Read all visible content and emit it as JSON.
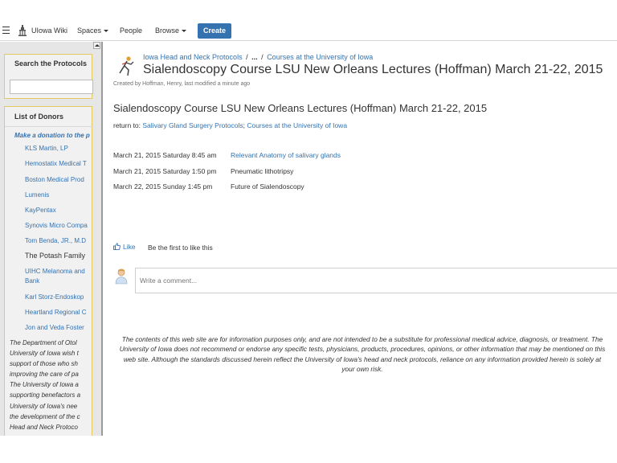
{
  "nav": {
    "site_name": "UIowa Wiki",
    "spaces": "Spaces",
    "people": "People",
    "browse": "Browse",
    "create": "Create"
  },
  "sidebar": {
    "search_title": "Search the Protocols",
    "donors_title": "List of Donors",
    "donate_link": "Make a donation to the p",
    "donors": [
      "KLS Martin, LP",
      "Hemostatix Medical T",
      "Boston Medical Prod",
      "Lumenis",
      "KayPentax",
      "Synovis Micro Compa",
      "Tom Benda, JR., M.D",
      "The Potash Family",
      "UIHC Melanoma and Bank",
      "Karl Storz-Endoskop",
      "Heartland Regional C",
      "Jon and Veda Foster"
    ],
    "paragraph_lines": [
      "The Department of Otol",
      "University of Iowa wish t",
      "support of those who sh",
      "improving the care of pa",
      "The University of Iowa a",
      "supporting benefactors a",
      "University of Iowa's nee",
      "the development of the c",
      "Head and Neck Protoco"
    ]
  },
  "page": {
    "breadcrumb": [
      "Iowa Head and Neck Protocols",
      "...",
      "Courses at the University of Iowa"
    ],
    "breadcrumb_sep": "/",
    "title": "Sialendoscopy Course LSU New Orleans Lectures (Hoffman) March 21-22, 2015",
    "byline": "Created by Hoffman, Henry, last modified a minute ago",
    "heading": "Sialendoscopy Course LSU New Orleans Lectures (Hoffman) March 21-22, 2015",
    "return_label": "return to: ",
    "return_links": [
      "Salivary Gland Surgery Protocols",
      "Courses at the University of Iowa"
    ],
    "return_sep": "; ",
    "schedule": [
      {
        "date": "March 21, 2015 Saturday 8:45 am",
        "topic": "Relevant Anatomy of salivary glands",
        "linked": true
      },
      {
        "date": "March 21, 2015 Saturday 1:50 pm",
        "topic": "Pneumatic lithotripsy",
        "linked": false
      },
      {
        "date": "March 22, 2015 Sunday 1:45 pm",
        "topic": "Future of Sialendoscopy",
        "linked": false
      }
    ],
    "like_label": "Like",
    "like_status": "Be the first to like this",
    "comment_placeholder": "Write a comment...",
    "disclaimer": "The contents of this web site are for information purposes only, and are not intended to be a substitute for professional medical advice, diagnosis, or treatment. The University of Iowa does not recommend or endorse any specific tests, physicians, products, procedures, opinions, or other information that may be mentioned on this web site. Although the standards discussed herein reflect the University of Iowa's head and neck protocols, reliance on any information provided herein is solely at your own risk."
  },
  "icons": {
    "menu": "menu-icon",
    "logo": "old-capitol-logo-icon",
    "page": "page-logo-icon",
    "thumb": "thumbs-up-icon",
    "avatar": "user-avatar-icon"
  },
  "colors": {
    "link": "#3572b0",
    "create_button": "#3572b0",
    "sidebar_panel_border": "#e3c95f"
  }
}
